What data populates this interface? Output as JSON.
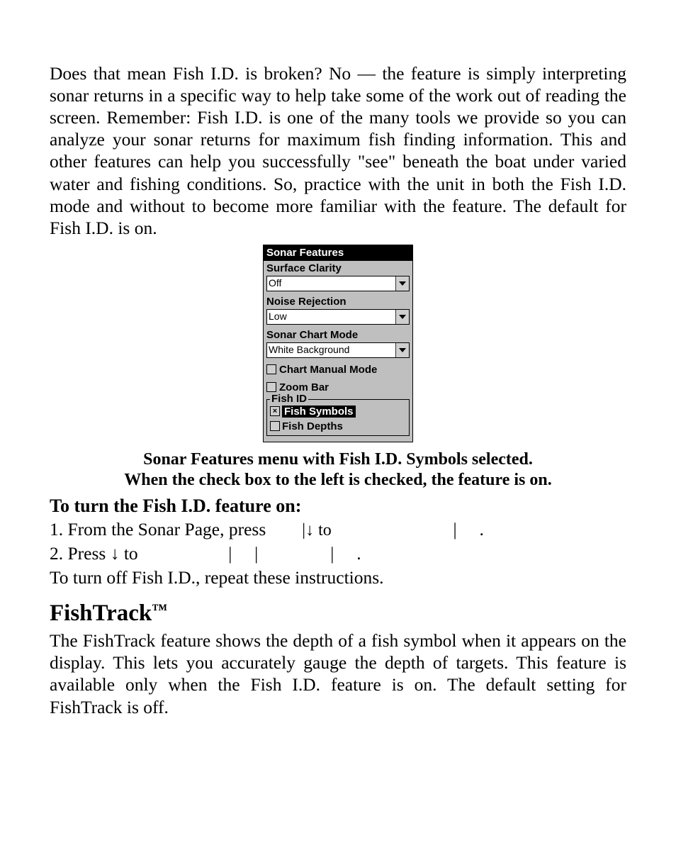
{
  "para1": "Does that mean Fish I.D. is broken? No — the feature is simply interpreting sonar returns in a specific way to help take some of the work out of reading the screen. Remember: Fish I.D. is one of the many tools we provide so you can analyze your sonar returns for maximum fish finding information. This and other features can help you successfully \"see\" beneath the boat under varied water and fishing conditions. So, practice with the unit in both the Fish I.D. mode and without to become more familiar with the feature. The default for Fish I.D. is on.",
  "panel": {
    "title": "Sonar Features",
    "surface_clarity_label": "Surface Clarity",
    "surface_clarity_value": "Off",
    "noise_rejection_label": "Noise Rejection",
    "noise_rejection_value": "Low",
    "sonar_chart_mode_label": "Sonar Chart Mode",
    "sonar_chart_mode_value": "White Background",
    "chart_manual_mode": "Chart Manual Mode",
    "zoom_bar": "Zoom Bar",
    "fish_id_legend": "Fish ID",
    "fish_symbols": "Fish Symbols",
    "fish_depths": "Fish Depths"
  },
  "caption_line1": "Sonar Features menu with Fish I.D. Symbols selected.",
  "caption_line2": "When the check box to the left is checked, the feature is on.",
  "subhead1": "To turn the Fish I.D. feature on:",
  "step1_a": "1. From the Sonar Page, press ",
  "step1_b": "|↓ to ",
  "step1_c": "|",
  "step1_d": ".",
  "step2_a": "2. Press ↓ to ",
  "step2_b": "|",
  "step2_c": "|",
  "step2_d": "|",
  "step2_e": ".",
  "plain1": "To turn off Fish I.D., repeat these instructions.",
  "h2_text": "FishTrack",
  "h2_tm": "™",
  "para2": "The FishTrack feature shows the depth of a fish symbol when it appears on the display. This lets you accurately gauge the depth of targets. This feature is available only when the Fish I.D. feature is on. The default setting for FishTrack is off."
}
